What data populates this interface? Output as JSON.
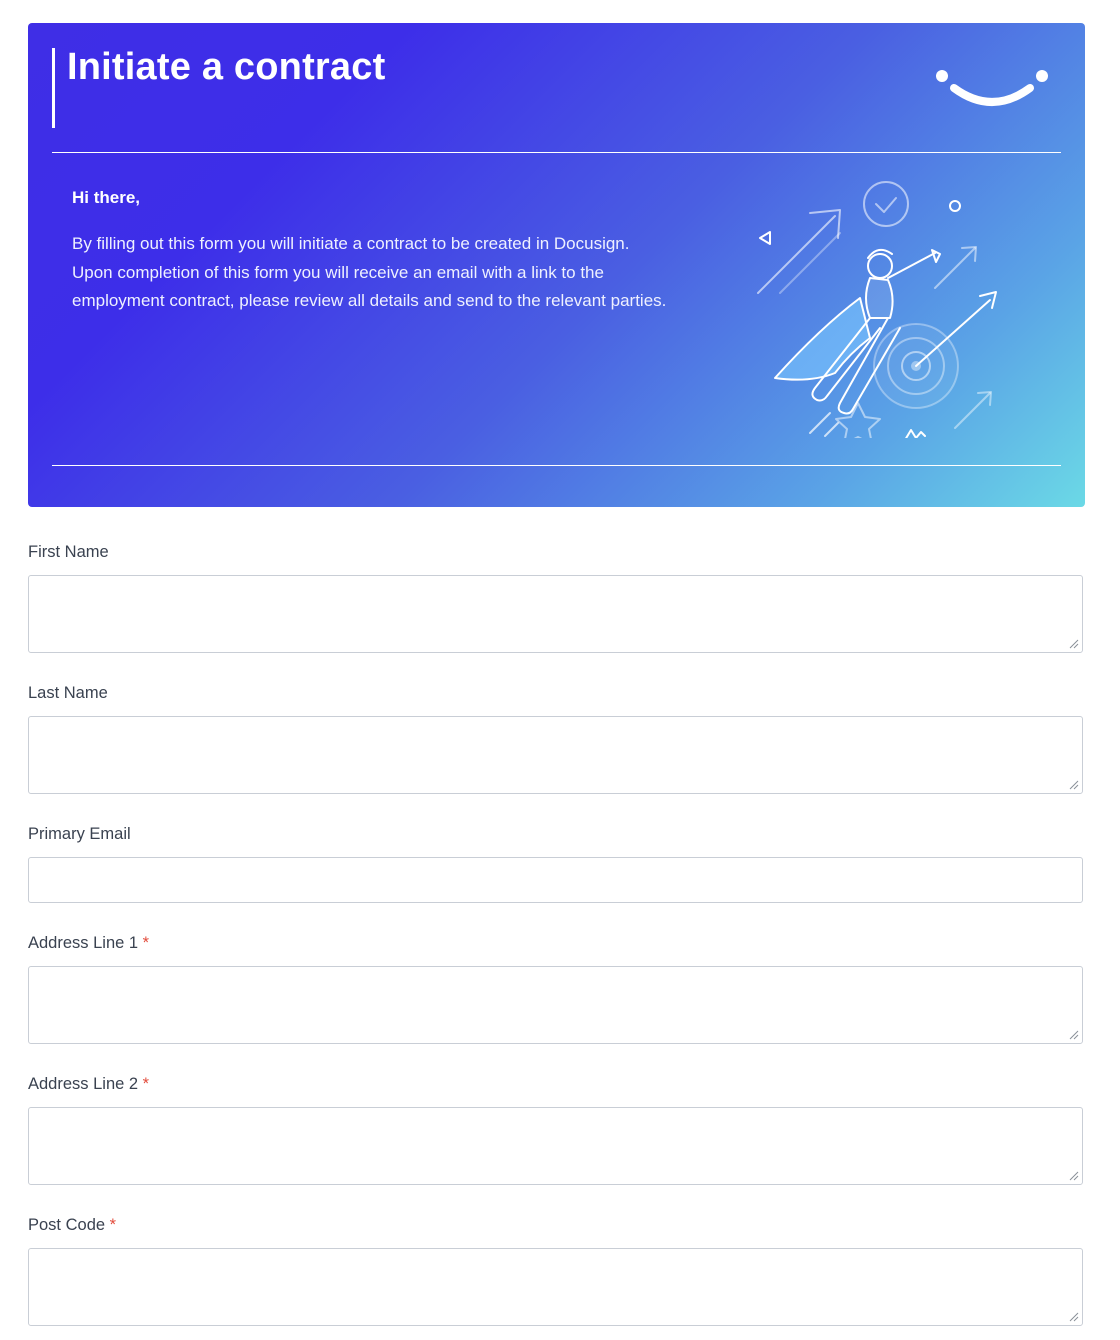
{
  "hero": {
    "title": "Initiate a contract",
    "greeting": "Hi there,",
    "intro": "By filling out this form you will initiate a contract to be created in Docusign. Upon completion of this form you will receive an email with a link to the employment contract, please review all details and send to the relevant parties.",
    "logo_icon": "smile-logo-icon",
    "illustration_icon": "superhero-target-illustration",
    "gradient_colors": [
      "#3d2ee9",
      "#4a5fe2",
      "#6bd9e6"
    ]
  },
  "form": {
    "required_marker": "*",
    "required_color": "#e24b3b",
    "fields": [
      {
        "label": "First Name",
        "value": "",
        "required": false,
        "type": "textarea"
      },
      {
        "label": "Last Name",
        "value": "",
        "required": false,
        "type": "textarea"
      },
      {
        "label": "Primary Email",
        "value": "",
        "required": false,
        "type": "input"
      },
      {
        "label": "Address Line 1",
        "value": "",
        "required": true,
        "type": "textarea"
      },
      {
        "label": "Address Line 2",
        "value": "",
        "required": true,
        "type": "textarea"
      },
      {
        "label": "Post Code",
        "value": "",
        "required": true,
        "type": "textarea"
      }
    ]
  }
}
